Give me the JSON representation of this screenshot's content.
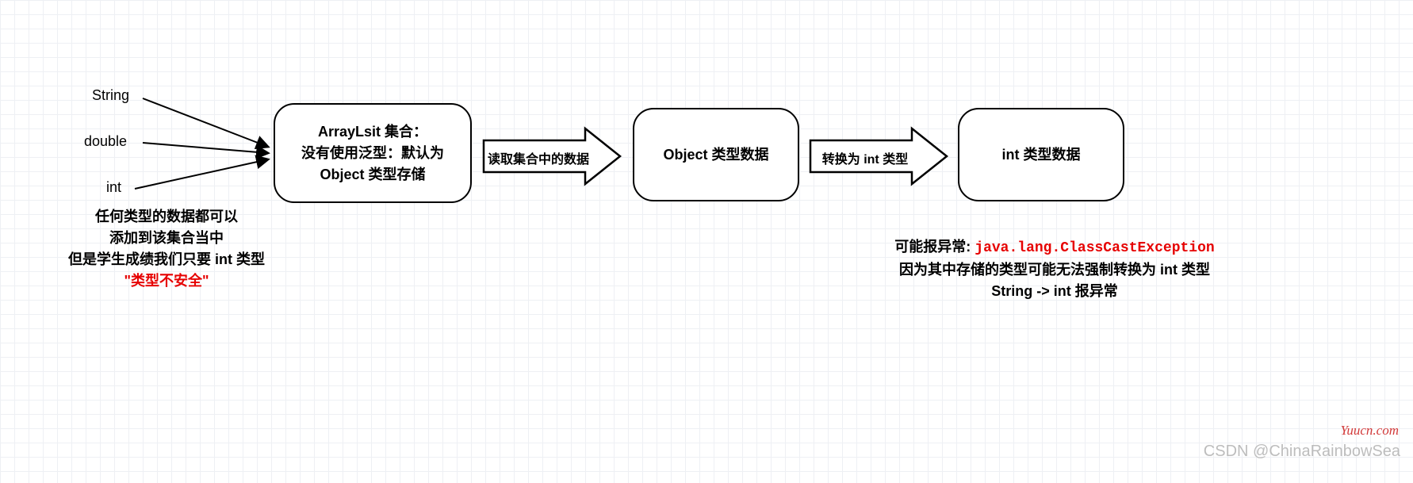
{
  "inputs": {
    "type1": "String",
    "type2": "double",
    "type3": "int"
  },
  "caption_left": {
    "line1": "任何类型的数据都可以",
    "line2": "添加到该集合当中",
    "line3": "但是学生成绩我们只要 int 类型",
    "line4": "\"类型不安全\""
  },
  "box1": {
    "line1": "ArrayLsit 集合：",
    "line2": "没有使用泛型：默认为",
    "line3": "Object 类型存储"
  },
  "arrow1_label": "读取集合中的数据",
  "box2": "Object 类型数据",
  "arrow2_label": "转换为 int 类型",
  "box3": "int 类型数据",
  "caption_right": {
    "prefix": "可能报异常: ",
    "exception": "java.lang.ClassCastException",
    "line2": "因为其中存储的类型可能无法强制转换为 int 类型",
    "line3": "String -> int 报异常"
  },
  "watermark_csdn": "CSDN @ChinaRainbowSea",
  "watermark_yuucn": "Yuucn.com"
}
